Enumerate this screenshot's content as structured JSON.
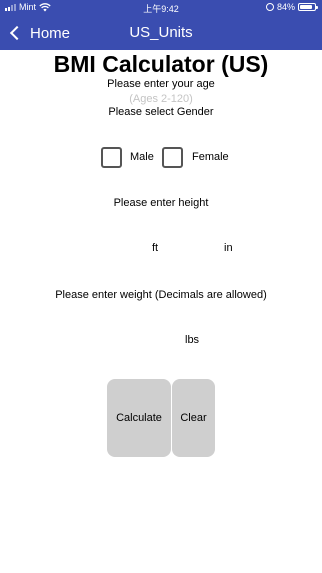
{
  "status_bar": {
    "carrier": "Mint",
    "time": "上午9:42",
    "battery": "84%",
    "battery_level": 0.84
  },
  "nav": {
    "back_label": "Home",
    "title": "US_Units"
  },
  "app": {
    "title": "BMI Calculator (US)",
    "age_prompt": "Please enter your age",
    "age_placeholder": "(Ages 2-120)",
    "gender_prompt": "Please select Gender",
    "gender_options": [
      "Male",
      "Female"
    ],
    "height_prompt": "Please enter height",
    "height_units": [
      "ft",
      "in"
    ],
    "weight_prompt": "Please enter weight (Decimals are allowed)",
    "weight_unit": "lbs",
    "buttons": {
      "calculate": "Calculate",
      "clear": "Clear"
    }
  },
  "colors": {
    "nav_background": "#3a4db0",
    "button_background": "#cfcfcf"
  }
}
